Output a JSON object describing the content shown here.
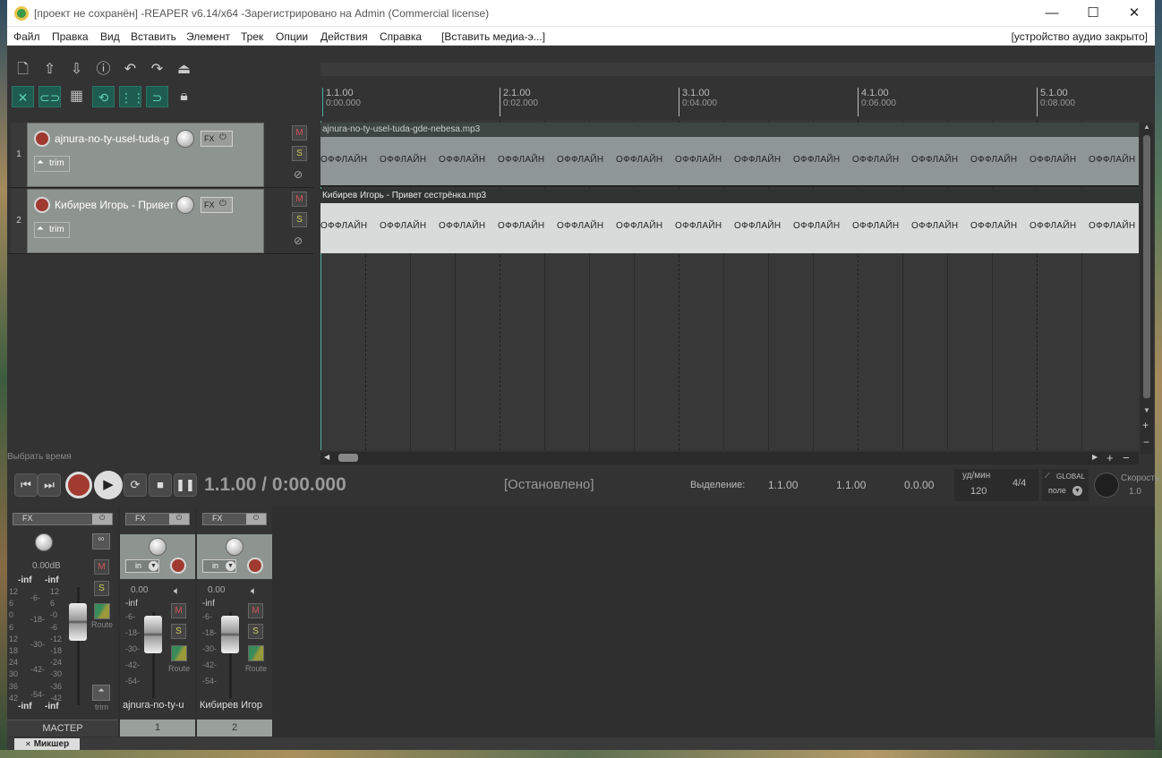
{
  "window": {
    "title": "[проект не сохранён] -REAPER v6.14/x64 -Зарегистрировано на Admin (Commercial license)",
    "controls": [
      "—",
      "☐",
      "✕"
    ]
  },
  "menu": {
    "items": [
      "Файл",
      "Правка",
      "Вид",
      "Вставить",
      "Элемент",
      "Трек",
      "Опции",
      "Действия",
      "Справка",
      "[Вставить медиа-э...]"
    ],
    "audio_status": "[устройство аудио закрыто]"
  },
  "toolbar": {
    "row1": [
      "new-project-icon",
      "open-project-icon",
      "save-project-icon",
      "info-icon",
      "undo-icon",
      "redo-icon",
      "metronome-icon"
    ],
    "row2": [
      "ripple-edit-icon",
      "link-icon",
      "grid-icon",
      "loop-item-icon",
      "snap-icon",
      "loop-icon",
      "lock-icon"
    ]
  },
  "ruler": {
    "markers": [
      {
        "bar": "1.1.00",
        "time": "0:00.000"
      },
      {
        "bar": "2.1.00",
        "time": "0:02.000"
      },
      {
        "bar": "3.1.00",
        "time": "0:04.000"
      },
      {
        "bar": "4.1.00",
        "time": "0:06.000"
      },
      {
        "bar": "5.1.00",
        "time": "0:08.000"
      }
    ]
  },
  "tracks": [
    {
      "number": "1",
      "name": "ajnura-no-ty-usel-tuda-g",
      "fx": "FX",
      "trim": "trim",
      "mute": "M",
      "solo": "S",
      "item_name": "ajnura-no-ty-usel-tuda-gde-nebesa.mp3",
      "offline_label": "ОФФЛАЙН"
    },
    {
      "number": "2",
      "name": "Кибирев Игорь - Привет",
      "fx": "FX",
      "trim": "trim",
      "mute": "M",
      "solo": "S",
      "item_name": "Кибирев Игорь - Привет сестрёнка.mp3",
      "offline_label": "ОФФЛАЙН"
    }
  ],
  "status_hint": "Выбрать время",
  "transport": {
    "position": "1.1.00 / 0:00.000",
    "state": "[Остановлено]",
    "selection_label": "Выделение:",
    "selection_start": "1.1.00",
    "selection_end": "1.1.00",
    "selection_length": "0.0.00",
    "bpm_label": "уд/мин",
    "bpm": "120",
    "time_signature": "4/4",
    "global_label": "GLOBAL",
    "global_mode": "поле",
    "rate_label": "Скорость",
    "rate": "1.0"
  },
  "mixer": {
    "master": {
      "fx": "FX",
      "volume": "0.00dB",
      "peak_l": "-inf",
      "peak_r": "-inf",
      "scale_left": [
        "12",
        "6",
        "0",
        "6",
        "12",
        "18",
        "24",
        "30",
        "36",
        "42"
      ],
      "scale_inner": [
        "-6-",
        "-18-",
        "-30-",
        "-42-",
        "-54-"
      ],
      "scale_right": [
        "12",
        "6",
        "-0",
        "-6",
        "-12",
        "-18",
        "-24",
        "-30",
        "-36",
        "-42"
      ],
      "mute": "M",
      "solo": "S",
      "route": "Route",
      "trim": "trim",
      "name": "МАСТЕР",
      "bottom_peak_l": "-inf",
      "bottom_peak_r": "-inf"
    },
    "channels": [
      {
        "fx": "FX",
        "input": "in",
        "volume": "0.00",
        "peak": "-inf",
        "scale": [
          "-6-",
          "-18-",
          "-30-",
          "-42-",
          "-54-"
        ],
        "mute": "M",
        "solo": "S",
        "route": "Route",
        "name": "ajnura-no-ty-u",
        "number": "1"
      },
      {
        "fx": "FX",
        "input": "in",
        "volume": "0.00",
        "peak": "-inf",
        "scale": [
          "-6-",
          "-18-",
          "-30-",
          "-42-",
          "-54-"
        ],
        "mute": "M",
        "solo": "S",
        "route": "Route",
        "name": "Кибирев Игор",
        "number": "2"
      }
    ],
    "tab": "Микшер"
  }
}
